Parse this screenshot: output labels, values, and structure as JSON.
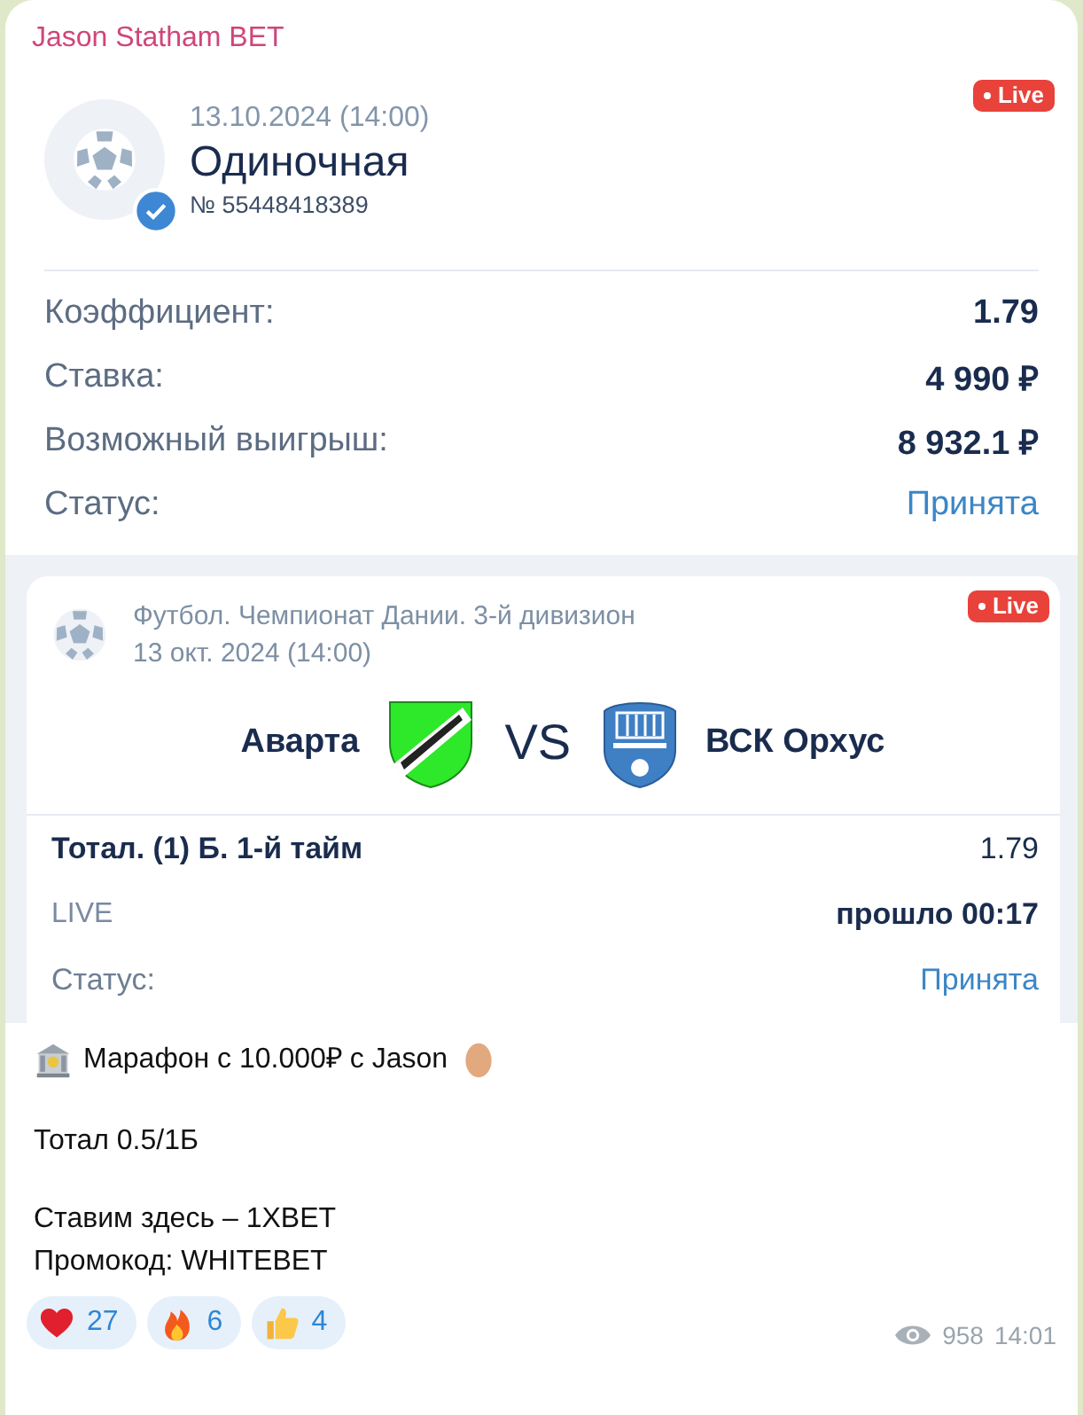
{
  "channel": {
    "name": "Jason Statham BET"
  },
  "bet": {
    "date": "13.10.2024 (14:00)",
    "type": "Одиночная",
    "number": "№ 55448418389",
    "live_badge": "Live",
    "verified": true,
    "details": [
      {
        "label": "Коэффициент:",
        "value": "1.79",
        "kind": "plain"
      },
      {
        "label": "Ставка:",
        "value": "4 990 ₽",
        "kind": "plain"
      },
      {
        "label": "Возможный выигрыш:",
        "value": "8 932.1 ₽",
        "kind": "plain"
      },
      {
        "label": "Статус:",
        "value": "Принята",
        "kind": "status"
      }
    ]
  },
  "event": {
    "league": "Футбол. Чемпионат Дании. 3-й дивизион",
    "date": "13 окт. 2024 (14:00)",
    "live_badge": "Live",
    "home": "Аварта",
    "vs": "VS",
    "away": "ВСК Орхус",
    "rows": [
      {
        "label": "Тотал. (1) Б. 1-й тайм",
        "value": "1.79",
        "kind": "market"
      },
      {
        "label": "LIVE",
        "value": "прошло 00:17",
        "kind": "live"
      },
      {
        "label": "Статус:",
        "value": "Принята",
        "kind": "status"
      }
    ]
  },
  "message": {
    "paragraphs": [
      {
        "kind": "intro",
        "lines": [
          "Марафон с 10.000₽ с Jason"
        ]
      },
      {
        "kind": "plain",
        "lines": [
          "Тотал 0.5/1Б"
        ]
      },
      {
        "kind": "plain",
        "lines": [
          "Ставим здесь – 1XBET",
          "Промокод: WHITEBET"
        ]
      }
    ]
  },
  "reactions": [
    {
      "kind": "heart",
      "count": "27"
    },
    {
      "kind": "fire",
      "count": "6"
    },
    {
      "kind": "thumbs",
      "count": "4"
    }
  ],
  "views": "958",
  "time": "14:01"
}
